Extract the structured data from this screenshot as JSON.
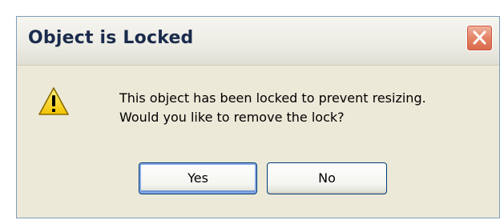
{
  "dialog": {
    "title": "Object is Locked",
    "message_lines": [
      "This object has been locked to prevent resizing.",
      "Would you like to remove the lock?"
    ],
    "icon": "warning-icon",
    "close_icon": "close-icon",
    "buttons": {
      "yes_label": "Yes",
      "no_label": "No"
    }
  },
  "colors": {
    "dialog_background": "#ece9d8",
    "window_border": "#7f9db9",
    "title_text": "#1a2b4c",
    "close_button": "#e07b5e",
    "default_button_focus": "#86a8e5",
    "button_border": "#003c74",
    "warning_fill": "#f5d400"
  }
}
